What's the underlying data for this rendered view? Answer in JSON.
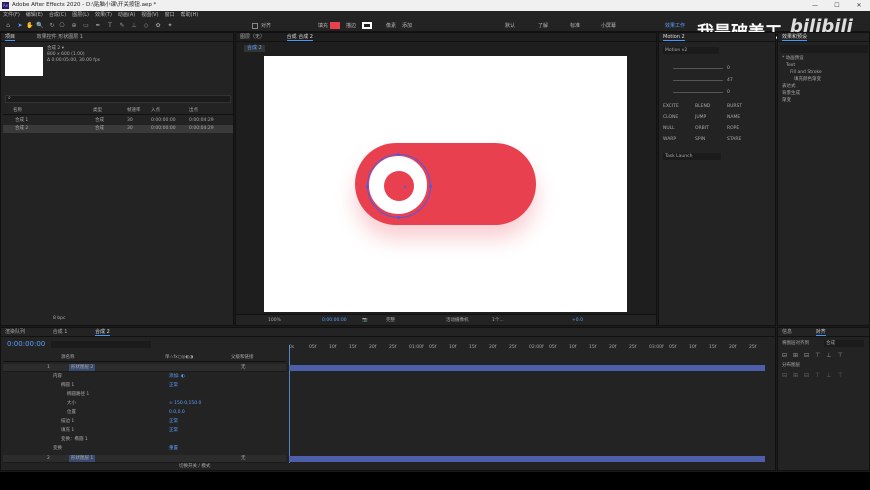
{
  "window": {
    "title": "Adobe After Effects 2020 - D:\\贴脑小课\\开关按钮.aep *",
    "logo": "Ae"
  },
  "menu": [
    "文件(F)",
    "编辑(E)",
    "合成(C)",
    "图层(L)",
    "效果(T)",
    "动画(A)",
    "视图(V)",
    "窗口",
    "帮助(H)"
  ],
  "toolbar": {
    "snap_label": "对齐",
    "fill_label": "填充",
    "stroke_label": "描边",
    "pixel_label": "像素",
    "add_label": "添加",
    "workspaces": [
      "默认",
      "了解",
      "标准",
      "小屏幕",
      "效果工作"
    ]
  },
  "project": {
    "tab_project": "项目",
    "tab_effects": "效果控件 形状图层 1",
    "comp_name": "合成 2 ▾",
    "comp_info": "800 x 600 (1.00)",
    "comp_duration": "Δ 0:00:05:00, 30.00 fps",
    "columns": [
      "名称",
      "类型",
      "帧速率",
      "入点",
      "出点"
    ],
    "items": [
      {
        "name": "合成 1",
        "type": "合成",
        "fps": "30",
        "in": "0:00:00:00",
        "out": "0:00:04:29"
      },
      {
        "name": "合成 2",
        "type": "合成",
        "fps": "30",
        "in": "0:00:00:00",
        "out": "0:00:04:29"
      }
    ],
    "bpc": "8 bpc"
  },
  "viewer": {
    "tab_layer": "图层（无）",
    "tab_comp": "合成 合成 2",
    "breadcrumb": "合成 2",
    "zoom": "100%",
    "timecode": "0:00:00:00",
    "resolution": "完整",
    "camera": "活动摄像机",
    "views": "1个...",
    "exposure": "+0.0"
  },
  "motion": {
    "tab": "Motion 2",
    "version": "Motion v2",
    "values": [
      "0",
      "47",
      "0"
    ],
    "buttons": [
      "EXCITE",
      "BLEND",
      "BURST",
      "CLONE",
      "JUMP",
      "NAME",
      "NULL",
      "ORBIT",
      "ROPE",
      "WARP",
      "SPIN",
      "STARE"
    ],
    "task": "Task Launch"
  },
  "effects_panel": {
    "tabs": [
      "效果和预设"
    ],
    "tree": [
      "* 动画预设",
      "Text",
      "Fill and Stroke",
      "填充颜色渐变",
      "表达式",
      "背景生成",
      "渐变"
    ]
  },
  "timeline": {
    "tab_render": "渲染队列",
    "tab_comp1": "合成 1",
    "tab_comp2": "合成 2",
    "timecode": "0:00:00:00",
    "columns": [
      "源名称",
      "单☆fx◻◎◐◑",
      "父级和链接"
    ],
    "ruler": [
      "0s",
      "05f",
      "10f",
      "15f",
      "20f",
      "25f",
      "01:00f",
      "05f",
      "10f",
      "15f",
      "20f",
      "25f",
      "02:00f",
      "05f",
      "10f",
      "15f",
      "20f",
      "25f",
      "03:00f",
      "05f",
      "10f",
      "15f",
      "20f",
      "25f"
    ],
    "layers": [
      {
        "num": "1",
        "name": "形状图层 2",
        "parent": "无"
      },
      {
        "num": "2",
        "name": "形状图层 1",
        "parent": "无"
      }
    ],
    "props": [
      {
        "label": "内容",
        "value": "添加: ◐"
      },
      {
        "label": "椭圆 1",
        "value": "正常"
      },
      {
        "label": "椭圆路径 1",
        "value": ""
      },
      {
        "label": "大小",
        "value": "∞ 150.0,150.0"
      },
      {
        "label": "位置",
        "value": "0.0,0.0"
      },
      {
        "label": "描边 1",
        "value": "正常"
      },
      {
        "label": "填充 1",
        "value": "正常"
      },
      {
        "label": "变换：椭圆 1",
        "value": ""
      },
      {
        "label": "变换",
        "value": "重置"
      }
    ],
    "footer": "切换开关 / 模式"
  },
  "align": {
    "tab_info": "信息",
    "tab_align": "对齐",
    "align_to_label": "将图层对齐到",
    "align_to_value": "合成",
    "distribute_label": "分布图层"
  },
  "watermark": "我是破美工",
  "brand": "bilibili"
}
